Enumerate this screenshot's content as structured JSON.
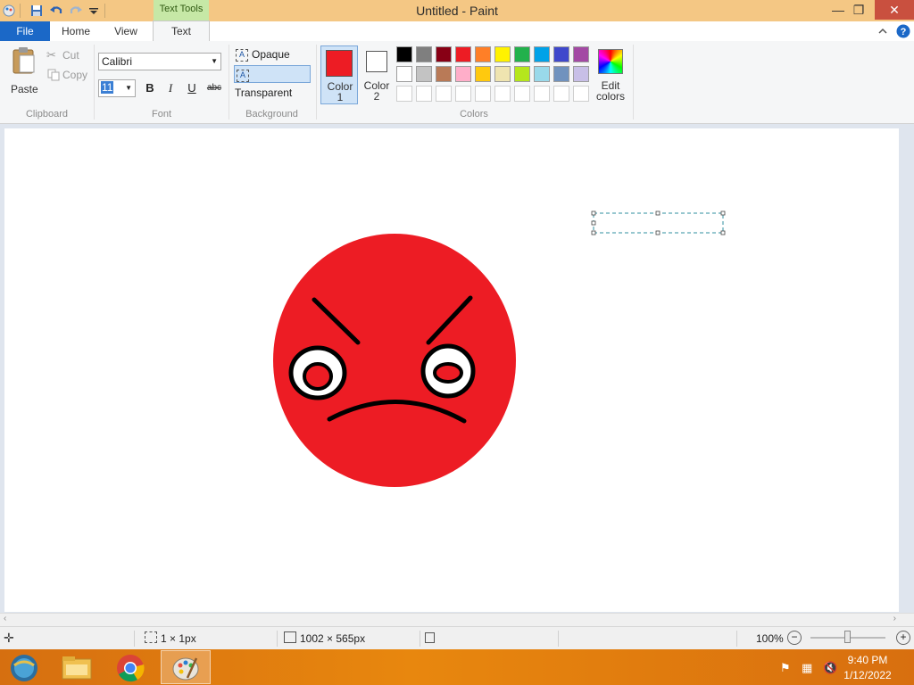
{
  "window": {
    "title": "Untitled - Paint",
    "context_tab_group": "Text Tools",
    "minimize": "—",
    "maximize": "❐",
    "close": "✕"
  },
  "tabs": [
    "File",
    "Home",
    "View",
    "Text"
  ],
  "ribbon": {
    "clipboard": {
      "paste": "Paste",
      "cut": "Cut",
      "copy": "Copy",
      "group": "Clipboard"
    },
    "font": {
      "family": "Calibri",
      "size": "11",
      "bold": "B",
      "italic": "I",
      "underline": "U",
      "strikethrough": "abc",
      "group": "Font"
    },
    "background": {
      "opaque": "Opaque",
      "transparent": "Transparent",
      "group": "Background"
    },
    "colors": {
      "color1_label": "Color\n1",
      "color1_line1": "Color",
      "color1_line2": "1",
      "color2_line1": "Color",
      "color2_line2": "2",
      "color1": "#ed1c24",
      "color2": "#ffffff",
      "edit_line1": "Edit",
      "edit_line2": "colors",
      "group": "Colors",
      "palette_row1": [
        "#000000",
        "#7f7f7f",
        "#880015",
        "#ed1c24",
        "#ff7f27",
        "#fff200",
        "#22b14c",
        "#00a2e8",
        "#3f48cc",
        "#a349a4"
      ],
      "palette_row2": [
        "#ffffff",
        "#c3c3c3",
        "#b97a57",
        "#ffaec9",
        "#ffc90e",
        "#efe4b0",
        "#b5e61d",
        "#99d9ea",
        "#7092be",
        "#c8bfe7"
      ]
    }
  },
  "canvas": {
    "fill_color": "#ed1c24",
    "stroke_color": "#000000"
  },
  "status": {
    "selection_size": "1 × 1px",
    "image_size": "1002 × 565px",
    "zoom": "100%"
  },
  "taskbar": {
    "apps": [
      "ie-icon",
      "file-explorer-icon",
      "chrome-icon",
      "paint-icon"
    ],
    "time": "9:40 PM",
    "date": "1/12/2022"
  }
}
